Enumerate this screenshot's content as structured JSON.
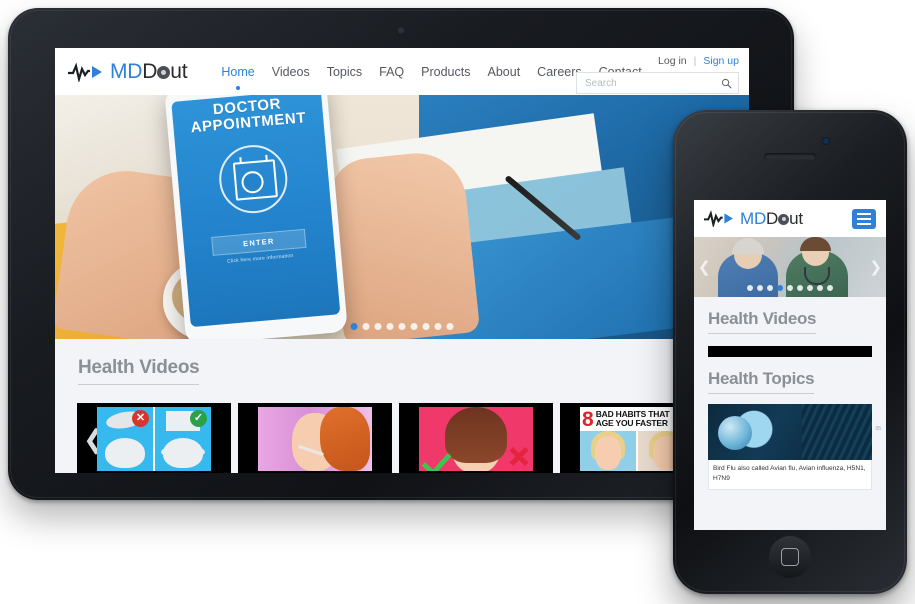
{
  "brand": {
    "name_md": "MD",
    "name_out_pre": "",
    "name_out_post": "ut",
    "full_name": "MDout",
    "accent_color": "#2f80d8",
    "logo_icon": "ekg-wave-play-icon"
  },
  "header": {
    "nav": [
      {
        "label": "Home",
        "active": true
      },
      {
        "label": "Videos",
        "active": false
      },
      {
        "label": "Topics",
        "active": false
      },
      {
        "label": "FAQ",
        "active": false
      },
      {
        "label": "Products",
        "active": false
      },
      {
        "label": "About",
        "active": false
      },
      {
        "label": "Careers",
        "active": false
      },
      {
        "label": "Contact",
        "active": false
      }
    ],
    "login_label": "Log in",
    "separator": "|",
    "signup_label": "Sign up",
    "search_placeholder": "Search",
    "search_value": "",
    "search_icon": "magnifier-icon"
  },
  "hero": {
    "headline_line1": "DOCTOR",
    "headline_line2": "APPOINTMENT",
    "button_label": "ENTER",
    "button_sub": "Click here more information",
    "icon": "calendar-stethoscope-icon",
    "slide_count": 9,
    "active_slide": 1
  },
  "videos_section": {
    "title": "Health Videos",
    "prev_arrow": "chevron-left-icon",
    "next_arrow": "chevron-right-icon",
    "thumbnails": [
      {
        "id": "toilet-lid",
        "caption": ""
      },
      {
        "id": "thermometer-woman",
        "caption": ""
      },
      {
        "id": "skincare-woman",
        "caption": ""
      },
      {
        "id": "bad-habits",
        "number": "8",
        "line1": "BAD HABITS THAT",
        "line2": "AGE YOU FASTER"
      }
    ]
  },
  "mobile": {
    "logo_md": "MD",
    "logo_out_post": "ut",
    "menu_icon": "hamburger-menu-icon",
    "hero": {
      "prev_arrow": "chevron-left-icon",
      "next_arrow": "chevron-right-icon",
      "slide_count": 9,
      "active_slide": 4
    },
    "videos_title": "Health Videos",
    "topics_title": "Health Topics",
    "topic": {
      "image": "globe-keyboard-stethoscope-image",
      "text": "Bird Flu also called Avian flu, Avian influenza, H5N1, H7N9",
      "badge": "05"
    }
  },
  "devices": {
    "tablet_name": "tablet-device",
    "phone_name": "smartphone-device",
    "tablet_camera": "front-camera",
    "phone_camera": "front-camera",
    "phone_home": "home-button"
  }
}
